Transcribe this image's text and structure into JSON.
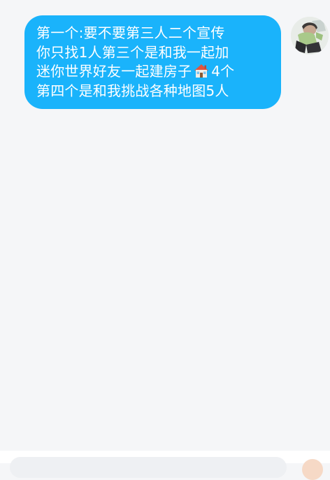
{
  "conversation": {
    "messages": [
      {
        "sender": "self",
        "lines": [
          "第一个:要不要第三人二个宣传",
          "你只找1人第三个是和我一起加",
          "迷你世界好友一起建房子",
          "4个",
          "第四个是和我挑战各种地图5人"
        ],
        "emoji": "house-icon"
      }
    ]
  },
  "colors": {
    "background": "#f5f6f8",
    "bubble": "#1ab3fb",
    "bubble_text": "#ffffff"
  }
}
